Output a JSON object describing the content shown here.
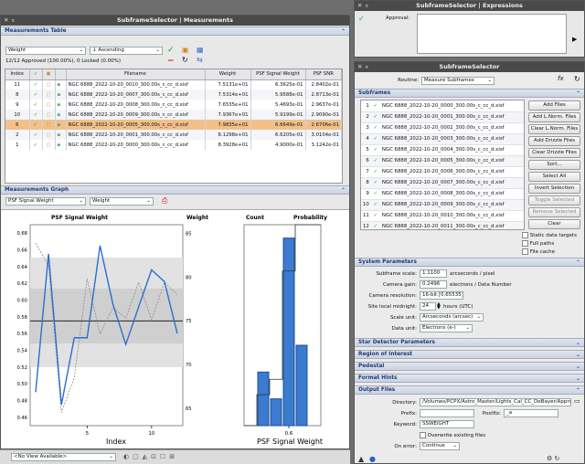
{
  "mwin": {
    "title": "SubframeSelector | Measurements",
    "table_title": "Measurements Table",
    "sort_field": "Weight",
    "sort_order": "Ascending",
    "status": "12/12 Approved (100.00%), 0 Locked (0.00%)",
    "cols": [
      "Index",
      "Filename",
      "Weight",
      "PSF Signal Weight",
      "PSF SNR"
    ],
    "rows": [
      {
        "i": "11",
        "f": "NGC 6888_2022-10-20_0010_300.00s_c_cc_d.xisf",
        "w": "7.5131e+01",
        "p": "6.3625e-01",
        "s": "2.8402e-01"
      },
      {
        "i": "8",
        "f": "NGC 6888_2022-10-20_0007_300.00s_c_cc_d.xisf",
        "w": "7.5314e+01",
        "p": "5.9588e-01",
        "s": "2.8713e-01"
      },
      {
        "i": "9",
        "f": "NGC 6888_2022-10-20_0008_300.00s_c_cc_d.xisf",
        "w": "7.6535e+01",
        "p": "5.4693e-01",
        "s": "2.9637e-01"
      },
      {
        "i": "10",
        "f": "NGC 6888_2022-10-20_0009_300.00s_c_cc_d.xisf",
        "w": "7.9367e+01",
        "p": "5.9199e-01",
        "s": "2.9090e-01"
      },
      {
        "i": "6",
        "f": "NGC 6888_2022-10-20_0005_300.00s_c_cc_d.xisf",
        "w": "7.9835e+01",
        "p": "6.6649e-01",
        "s": "2.6706e-01"
      },
      {
        "i": "2",
        "f": "NGC 6888_2022-10-20_0001_300.00s_c_cc_d.xisf",
        "w": "8.1298e+01",
        "p": "6.6205e-01",
        "s": "3.0104e-01"
      },
      {
        "i": "1",
        "f": "NGC 6888_2022-10-20_0000_300.00s_c_cc_d.xisf",
        "w": "8.3928e+01",
        "p": "4.9000e-01",
        "s": "3.1242e-01"
      }
    ],
    "graph_title": "Measurements Graph",
    "graph_y": "PSF Signal Weight",
    "graph_y2": "Weight",
    "chart_title_left": "PSF Signal Weight",
    "chart_title_right": "Weight",
    "xlabel": "Index",
    "hist_title_left": "Count",
    "hist_title_right": "Probability",
    "hist_xlabel": "PSF Signal Weight",
    "bottom_view": "<No View Available>"
  },
  "chart_data": [
    {
      "type": "line",
      "title": "PSF Signal Weight / Weight",
      "xlabel": "Index",
      "ylabel": "PSF Signal Weight",
      "y2label": "Weight",
      "x": [
        1,
        2,
        3,
        4,
        5,
        6,
        7,
        8,
        9,
        10,
        11,
        12
      ],
      "xticks": [
        "5",
        "10"
      ],
      "ylim": [
        0.45,
        0.69
      ],
      "y2lim": [
        63,
        86
      ],
      "yticks": [
        "0.68",
        "0.66",
        "0.64",
        "0.62",
        "0.60",
        "0.58",
        "0.56",
        "0.54",
        "0.52",
        "0.50",
        "0.48",
        "0.46"
      ],
      "y2ticks": [
        "85",
        "80",
        "75",
        "70",
        "65"
      ],
      "series": [
        {
          "values": [
            0.49,
            0.655,
            0.475,
            0.555,
            0.555,
            0.665,
            0.595,
            0.547,
            0.592,
            0.636,
            0.622,
            0.56
          ]
        },
        {
          "values": [
            83.9,
            81.3,
            64.5,
            68.5,
            79.8,
            73.5,
            76.5,
            75.3,
            79.4,
            75.1,
            79.4,
            78.0
          ]
        }
      ],
      "median": 0.575
    },
    {
      "type": "bar",
      "title": "Count / Probability",
      "xlabel": "PSF Signal Weight",
      "categories": [
        "0.46",
        "0.50",
        "0.54",
        "0.58",
        "0.62",
        "0.66"
      ],
      "values": [
        0,
        2,
        1,
        7,
        3,
        0
      ],
      "xticks": [
        "0.6"
      ]
    }
  ],
  "expr": {
    "title": "SubframeSelector | Expressions",
    "approval": "Approval:"
  },
  "ss": {
    "title": "SubframeSelector",
    "routine_label": "Routine:",
    "routine": "Measure Subframes",
    "sec_subframes": "Subframes",
    "files": [
      "NGC 6888_2022-10-20_0000_300.00s_c_cc_d.xisf",
      "NGC 6888_2022-10-20_0001_300.00s_c_cc_d.xisf",
      "NGC 6888_2022-10-20_0002_300.00s_c_cc_d.xisf",
      "NGC 6888_2022-10-20_0003_300.00s_c_cc_d.xisf",
      "NGC 6888_2022-10-20_0004_300.00s_c_cc_d.xisf",
      "NGC 6888_2022-10-20_0005_300.00s_c_cc_d.xisf",
      "NGC 6888_2022-10-20_0006_300.00s_c_cc_d.xisf",
      "NGC 6888_2022-10-20_0007_300.00s_c_cc_d.xisf",
      "NGC 6888_2022-10-20_0008_300.00s_c_cc_d.xisf",
      "NGC 6888_2022-10-20_0009_300.00s_c_cc_d.xisf",
      "NGC 6888_2022-10-20_0010_300.00s_c_cc_d.xisf",
      "NGC 6888_2022-10-20_0011_300.00s_c_cc_d.xisf"
    ],
    "buttons": [
      "Add Files",
      "Add L.Norm. Files",
      "Clear L.Norm. Files",
      "Add Drizzle Files",
      "Clear Drizzle Files",
      "Sort...",
      "Select All",
      "Invert Selection",
      "Toggle Selected",
      "Remove Selected",
      "Clear"
    ],
    "chk_static": "Static data targets",
    "chk_full": "Full paths",
    "chk_cache": "File cache",
    "sec_system": "System Parameters",
    "scale_label": "Subframe scale:",
    "scale": "1.1100",
    "scale_unit": "arcseconds / pixel",
    "gain_label": "Camera gain:",
    "gain": "0.2496",
    "gain_unit": "electrons / Data Number",
    "res_label": "Camera resolution:",
    "res": "16-bit [0,65535]",
    "midnight_label": "Site local midnight:",
    "midnight": "24",
    "midnight_unit": "hours (UTC)",
    "scaleunit_label": "Scale unit:",
    "scaleunit": "Arcseconds (arcsec)",
    "dataunit_label": "Data unit:",
    "dataunit": "Electrons (e-)",
    "sec_star": "Star Detector Parameters",
    "sec_roi": "Region of Interest",
    "sec_ped": "Pedestal",
    "sec_fmt": "Format Hints",
    "sec_out": "Output Files",
    "dir_label": "Directory:",
    "dir": "/Volumes/PCPX/Astro_Master/Lights_Cal_CC_DeBayer/Approved",
    "prefix_label": "Prefix:",
    "prefix": "",
    "postfix_label": "Postfix:",
    "postfix": "_a",
    "keyword_label": "Keyword:",
    "keyword": "SSWEIGHT",
    "overwrite": "Overwrite existing files",
    "onerror_label": "On error:",
    "onerror": "Continue"
  }
}
